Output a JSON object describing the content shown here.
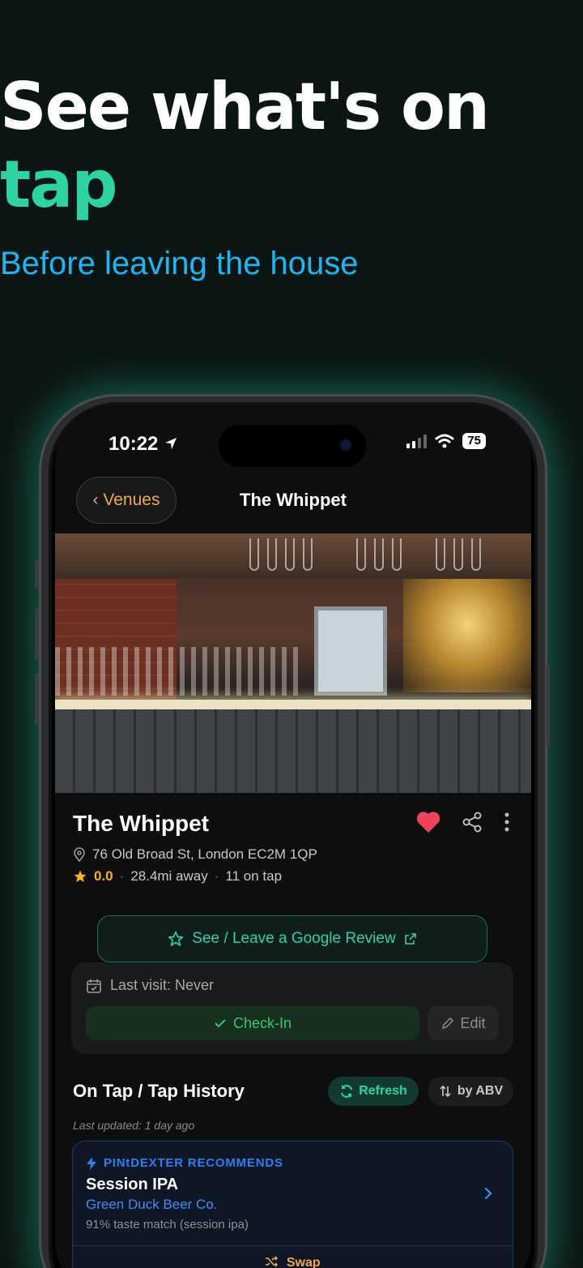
{
  "promo": {
    "headline": "See what's on",
    "headline_accent": "tap",
    "subheadline": "Before leaving the house"
  },
  "status_bar": {
    "time": "10:22",
    "battery": "75"
  },
  "nav": {
    "back_label": "‹ Venues",
    "title": "The Whippet"
  },
  "venue": {
    "name": "The Whippet",
    "address": "76 Old Broad St, London EC2M 1QP",
    "rating": "0.0",
    "distance": "28.4mi away",
    "on_tap": "11 on tap"
  },
  "actions": {
    "review_label": "See / Leave a Google Review",
    "last_visit": "Last visit: Never",
    "checkin_label": "Check-In",
    "edit_label": "Edit"
  },
  "tap_section": {
    "title": "On Tap / Tap History",
    "refresh_label": "Refresh",
    "sort_label": "by ABV",
    "last_updated": "Last updated: 1 day ago"
  },
  "recommendation": {
    "label": "PINtDEXTER RECOMMENDS",
    "beer_name": "Session IPA",
    "brewery": "Green Duck Beer Co.",
    "match": "91% taste match (session ipa)",
    "swap_label": "Swap"
  },
  "colors": {
    "background": "#0b1513",
    "accent_green": "#2ed3a3",
    "accent_blue": "#1fb6f0",
    "accent_orange": "#f0a84a",
    "heart_red": "#f2415b",
    "star_gold": "#f2b419"
  },
  "icons": {
    "location": "location-pin-icon",
    "heart": "heart-icon",
    "share": "share-icon",
    "more": "more-vertical-icon",
    "star": "star-icon",
    "external": "external-link-icon",
    "calendar": "calendar-icon",
    "check": "check-icon",
    "pencil": "pencil-icon",
    "refresh": "refresh-icon",
    "sort": "sort-icon",
    "bolt": "bolt-icon",
    "chevron": "chevron-right-icon",
    "shuffle": "shuffle-icon"
  }
}
